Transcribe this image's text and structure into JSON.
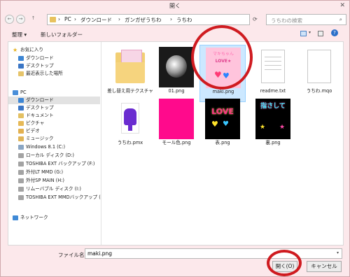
{
  "window": {
    "title": "開く",
    "close_glyph": "✕"
  },
  "address": {
    "back_glyph": "←",
    "forward_glyph": "→",
    "up_glyph": "↑",
    "crumbs": [
      "PC",
      "ダウンロード",
      "ガンガぜうちわ",
      "うちわ"
    ],
    "separator": "›",
    "search_placeholder": "うちわの検索"
  },
  "toolbar": {
    "organize_label": "整理 ▾",
    "new_folder_label": "新しいフォルダー"
  },
  "nav": {
    "favorites_label": "お気に入り",
    "favorites": [
      "ダウンロード",
      "デスクトップ",
      "最近表示した場所"
    ],
    "pc_label": "PC",
    "pc_items": [
      "ダウンロード",
      "デスクトップ",
      "ドキュメント",
      "ピクチャ",
      "ビデオ",
      "ミュージック",
      "Windows 8.1 (C:)",
      "ローカル ディスク (D:)",
      "TOSHIBA EXT バックアップ (F:)",
      "外付LT MMD (G:)",
      "外付SP MAIN (H:)",
      "リムーバブル ディスク (I:)",
      "TOSHIBA EXT MMDバックアップ ("
    ],
    "network_label": "ネットワーク"
  },
  "files": [
    {
      "name": "差し替え用テクスチャ",
      "kind": "folder"
    },
    {
      "name": "01.png",
      "kind": "image"
    },
    {
      "name": "maki.png",
      "kind": "image",
      "thumb_text": "マキちゃん",
      "thumb_text2": "LOVE★"
    },
    {
      "name": "readme.txt",
      "kind": "text"
    },
    {
      "name": "うちわ.mqo",
      "kind": "file"
    },
    {
      "name": "うちわ.pmx",
      "kind": "pmx"
    },
    {
      "name": "モール色.png",
      "kind": "image"
    },
    {
      "name": "表.png",
      "kind": "image",
      "thumb_text": "LOVE"
    },
    {
      "name": "裏.png",
      "kind": "image",
      "thumb_text": "指さして"
    }
  ],
  "bottom": {
    "filename_label": "ファイル名(N):",
    "filename_value": "maki.png",
    "open_label": "開く(O)",
    "cancel_label": "キャンセル"
  },
  "colors": {
    "window_bg": "#fce8eb",
    "selection": "#cce8ff",
    "annotation_red": "#cf1b20"
  }
}
